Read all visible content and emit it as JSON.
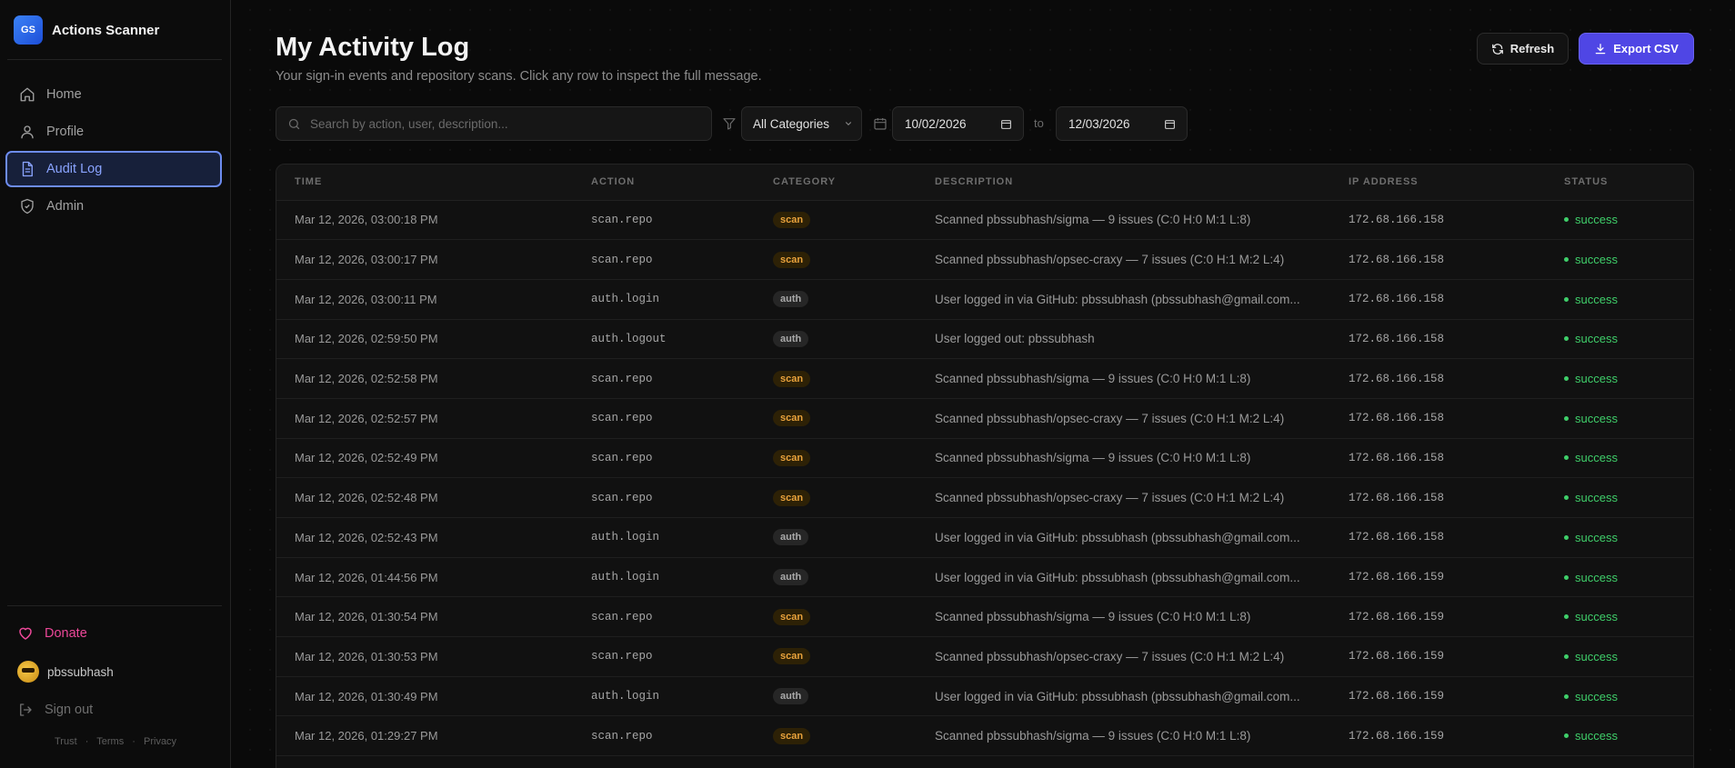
{
  "app": {
    "logo_text": "GS",
    "name": "Actions Scanner"
  },
  "sidebar": {
    "items": [
      {
        "label": "Home",
        "icon": "home-icon",
        "active": false
      },
      {
        "label": "Profile",
        "icon": "user-icon",
        "active": false
      },
      {
        "label": "Audit Log",
        "icon": "document-icon",
        "active": true
      },
      {
        "label": "Admin",
        "icon": "shield-icon",
        "active": false
      }
    ],
    "donate_label": "Donate",
    "username": "pbssubhash",
    "signout_label": "Sign out",
    "footer": {
      "trust": "Trust",
      "terms": "Terms",
      "privacy": "Privacy",
      "sep": "·"
    }
  },
  "header": {
    "title": "My Activity Log",
    "subtitle": "Your sign-in events and repository scans. Click any row to inspect the full message.",
    "refresh_label": "Refresh",
    "export_label": "Export CSV"
  },
  "filters": {
    "search_placeholder": "Search by action, user, description...",
    "category_selected": "All Categories",
    "date_from": "10/02/2026",
    "to_label": "to",
    "date_to": "12/03/2026"
  },
  "table": {
    "columns": [
      "TIME",
      "ACTION",
      "CATEGORY",
      "DESCRIPTION",
      "IP ADDRESS",
      "STATUS"
    ],
    "rows": [
      {
        "time": "Mar 12, 2026, 03:00:18 PM",
        "action": "scan.repo",
        "category": "scan",
        "description": "Scanned pbssubhash/sigma — 9 issues (C:0 H:0 M:1 L:8)",
        "ip": "172.68.166.158",
        "status": "success"
      },
      {
        "time": "Mar 12, 2026, 03:00:17 PM",
        "action": "scan.repo",
        "category": "scan",
        "description": "Scanned pbssubhash/opsec-craxy — 7 issues (C:0 H:1 M:2 L:4)",
        "ip": "172.68.166.158",
        "status": "success"
      },
      {
        "time": "Mar 12, 2026, 03:00:11 PM",
        "action": "auth.login",
        "category": "auth",
        "description": "User logged in via GitHub: pbssubhash (pbssubhash@gmail.com...",
        "ip": "172.68.166.158",
        "status": "success"
      },
      {
        "time": "Mar 12, 2026, 02:59:50 PM",
        "action": "auth.logout",
        "category": "auth",
        "description": "User logged out: pbssubhash",
        "ip": "172.68.166.158",
        "status": "success"
      },
      {
        "time": "Mar 12, 2026, 02:52:58 PM",
        "action": "scan.repo",
        "category": "scan",
        "description": "Scanned pbssubhash/sigma — 9 issues (C:0 H:0 M:1 L:8)",
        "ip": "172.68.166.158",
        "status": "success"
      },
      {
        "time": "Mar 12, 2026, 02:52:57 PM",
        "action": "scan.repo",
        "category": "scan",
        "description": "Scanned pbssubhash/opsec-craxy — 7 issues (C:0 H:1 M:2 L:4)",
        "ip": "172.68.166.158",
        "status": "success"
      },
      {
        "time": "Mar 12, 2026, 02:52:49 PM",
        "action": "scan.repo",
        "category": "scan",
        "description": "Scanned pbssubhash/sigma — 9 issues (C:0 H:0 M:1 L:8)",
        "ip": "172.68.166.158",
        "status": "success"
      },
      {
        "time": "Mar 12, 2026, 02:52:48 PM",
        "action": "scan.repo",
        "category": "scan",
        "description": "Scanned pbssubhash/opsec-craxy — 7 issues (C:0 H:1 M:2 L:4)",
        "ip": "172.68.166.158",
        "status": "success"
      },
      {
        "time": "Mar 12, 2026, 02:52:43 PM",
        "action": "auth.login",
        "category": "auth",
        "description": "User logged in via GitHub: pbssubhash (pbssubhash@gmail.com...",
        "ip": "172.68.166.158",
        "status": "success"
      },
      {
        "time": "Mar 12, 2026, 01:44:56 PM",
        "action": "auth.login",
        "category": "auth",
        "description": "User logged in via GitHub: pbssubhash (pbssubhash@gmail.com...",
        "ip": "172.68.166.159",
        "status": "success"
      },
      {
        "time": "Mar 12, 2026, 01:30:54 PM",
        "action": "scan.repo",
        "category": "scan",
        "description": "Scanned pbssubhash/sigma — 9 issues (C:0 H:0 M:1 L:8)",
        "ip": "172.68.166.159",
        "status": "success"
      },
      {
        "time": "Mar 12, 2026, 01:30:53 PM",
        "action": "scan.repo",
        "category": "scan",
        "description": "Scanned pbssubhash/opsec-craxy — 7 issues (C:0 H:1 M:2 L:4)",
        "ip": "172.68.166.159",
        "status": "success"
      },
      {
        "time": "Mar 12, 2026, 01:30:49 PM",
        "action": "auth.login",
        "category": "auth",
        "description": "User logged in via GitHub: pbssubhash (pbssubhash@gmail.com...",
        "ip": "172.68.166.159",
        "status": "success"
      },
      {
        "time": "Mar 12, 2026, 01:29:27 PM",
        "action": "scan.repo",
        "category": "scan",
        "description": "Scanned pbssubhash/sigma — 9 issues (C:0 H:0 M:1 L:8)",
        "ip": "172.68.166.159",
        "status": "success"
      }
    ]
  },
  "colors": {
    "accent": "#4f46e5",
    "active_nav": "#8aa4ff",
    "scan_badge": "#e9a23b",
    "success": "#3fcf6a",
    "donate": "#ec4899"
  }
}
